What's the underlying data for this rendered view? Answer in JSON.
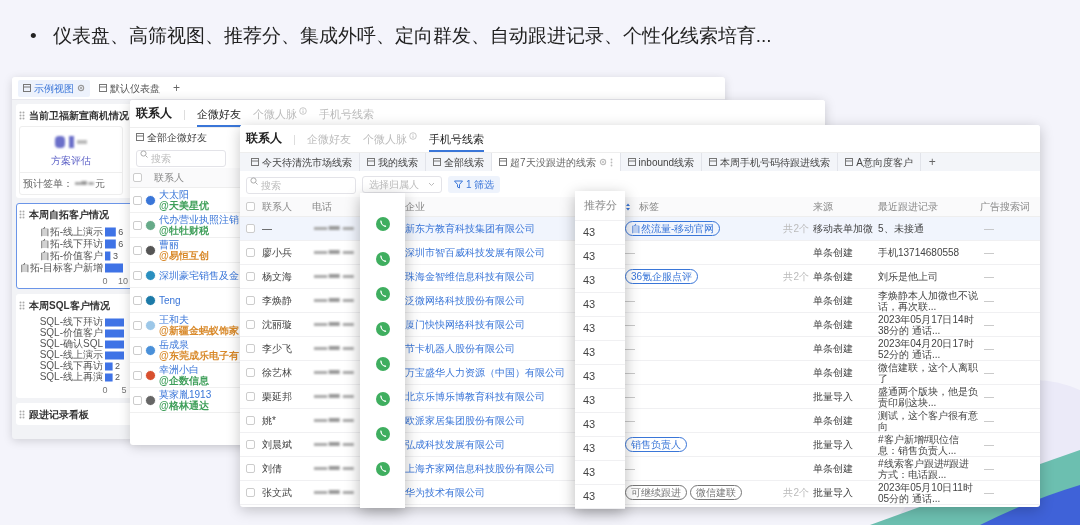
{
  "headline": {
    "bullet": "•",
    "text": "仪表盘、高筛视图、推荐分、集成外呼、定向群发、自动跟进记录、个性化线索培育..."
  },
  "dashboard_window": {
    "tabs": [
      {
        "label": "示例视图",
        "selected": true
      },
      {
        "label": "默认仪表盘",
        "selected": false
      }
    ],
    "add_tab": "+",
    "cards": [
      {
        "kind": "metric",
        "title": "当前卫福新宣商机情况",
        "selected": false,
        "metric_label": "方案评估",
        "footer_label": "预计签单：",
        "footer_unit": "元"
      },
      {
        "kind": "chart",
        "title": "本周自拓客户情况",
        "selected": true,
        "chart_data": {
          "type": "bar",
          "orientation": "horizontal",
          "categories": [
            "自拓-线上演示",
            "自拓-线下拜访",
            "自拓-价值客户",
            "自拓-目标客户新增"
          ],
          "values": [
            6,
            6,
            3,
            10
          ],
          "value_labels": [
            "6",
            "6",
            "3",
            null
          ],
          "xlim": [
            0,
            10
          ],
          "xticks": [
            0,
            10
          ]
        }
      },
      {
        "kind": "chart",
        "title": "本周SQL客户情况",
        "selected": false,
        "chart_data": {
          "type": "bar",
          "orientation": "horizontal",
          "categories": [
            "SQL-线下拜访",
            "SQL-价值客户",
            "SQL-确认SQL",
            "SQL-线上演示",
            "SQL-线下再访",
            "SQL-线上再演"
          ],
          "values": [
            5,
            5,
            5,
            5,
            2,
            2
          ],
          "value_labels": [
            null,
            null,
            null,
            null,
            "2",
            "2"
          ],
          "xlim": [
            0,
            5
          ],
          "xticks": [
            0,
            5
          ]
        }
      },
      {
        "kind": "empty",
        "title": "跟进记录看板",
        "selected": false
      }
    ]
  },
  "friends_window": {
    "title": "联系人",
    "tabs": [
      {
        "label": "企微好友",
        "selected": true,
        "info": false
      },
      {
        "label": "个微人脉",
        "selected": false,
        "info": true
      },
      {
        "label": "手机号线索",
        "selected": false,
        "info": false
      }
    ],
    "views": [
      {
        "label": "全部企微好友"
      }
    ],
    "search_placeholder": "搜索",
    "column": "联系人",
    "all_checked": false,
    "rows": [
      {
        "name": "大太阳",
        "company": "@天美星优",
        "color": "#3f9f5a",
        "checked": false
      },
      {
        "name": "代办营业执照注销",
        "company": "@牡牡财税",
        "color": "#3f9f5a",
        "checked": false
      },
      {
        "name": "曹丽",
        "company": "@易恒互创",
        "color": "#d98a2b",
        "checked": false
      },
      {
        "name": "深圳豪宅销售及金",
        "checked": false
      },
      {
        "name": "Teng",
        "checked": false
      },
      {
        "name": "王和夫",
        "company": "@新疆金蚂蚁饰家",
        "color": "#d98a2b",
        "checked": false
      },
      {
        "name": "岳成泉",
        "company": "@东莞成乐电子有",
        "color": "#d98a2b",
        "checked": false
      },
      {
        "name": "幸洲小白",
        "company": "@企数信息",
        "color": "#3f9f5a",
        "checked": false
      },
      {
        "name": "莫家胤1913",
        "company": "@格林通达",
        "color": "#3f9f5a",
        "checked": false
      }
    ]
  },
  "leads_window": {
    "title": "联系人",
    "tabs": [
      {
        "label": "企微好友",
        "selected": false,
        "info": false
      },
      {
        "label": "个微人脉",
        "selected": false,
        "info": true
      },
      {
        "label": "手机号线索",
        "selected": true,
        "info": false
      }
    ],
    "views": [
      {
        "label": "今天待清洗市场线索",
        "selected": false
      },
      {
        "label": "我的线索",
        "selected": false
      },
      {
        "label": "全部线索",
        "selected": false
      },
      {
        "label": "超7天没跟进的线索",
        "selected": true
      },
      {
        "label": "inbound线索",
        "selected": false
      },
      {
        "label": "本周手机号码待跟进线索",
        "selected": false
      },
      {
        "label": "A意向度客户",
        "selected": false
      }
    ],
    "add_view": "+",
    "search_placeholder": "搜索",
    "all_checked": false,
    "owner_select": "选择归属人",
    "filter_button": "1 筛选",
    "columns": [
      "联系人",
      "电话",
      "企业",
      "推荐分",
      "标签",
      "来源",
      "最近跟进记录",
      "广告搜索词"
    ],
    "rows": [
      {
        "name": "—",
        "company": "新东方教育科技集团有限公司",
        "score": "43",
        "tags": [
          {
            "label": "自然流量-移动官网",
            "color": "#3a76d8"
          }
        ],
        "tag_count": "共2个",
        "source": "移动表单加微",
        "followup": "5、未接通",
        "ad_keyword": "—",
        "selected": true
      },
      {
        "name": "廖小兵",
        "company": "深圳市智百威科技发展有限公司",
        "score": "43",
        "tag_text": "—",
        "source": "单条创建",
        "followup": "手机13714680558",
        "ad_keyword": "—",
        "selected": false
      },
      {
        "name": "杨文海",
        "company": "珠海金智维信息科技有限公司",
        "score": "43",
        "tags": [
          {
            "label": "36氪企服点评",
            "color": "#3a76d8"
          }
        ],
        "tag_count": "共2个",
        "source": "单条创建",
        "followup": "刘乐是他上司",
        "ad_keyword": "—",
        "selected": false
      },
      {
        "name": "李焕静",
        "company": "泛微网络科技股份有限公司",
        "score": "43",
        "tag_text": "—",
        "source": "单条创建",
        "followup": "李焕静本人加微也不说话，再次联...",
        "ad_keyword": "—",
        "selected": false
      },
      {
        "name": "沈丽璇",
        "company": "厦门快快网络科技有限公司",
        "score": "43",
        "tag_text": "—",
        "source": "单条创建",
        "followup": "2023年05月17日14时38分的 通话...",
        "ad_keyword": "—",
        "selected": false
      },
      {
        "name": "李少飞",
        "company": "节卡机器人股份有限公司",
        "score": "43",
        "tag_text": "—",
        "source": "单条创建",
        "followup": "2023年04月20日17时52分的 通话...",
        "ad_keyword": "—",
        "selected": false
      },
      {
        "name": "徐艺林",
        "company": "万宝盛华人力资源（中国）有限公司",
        "score": "43",
        "tag_text": "—",
        "source": "单条创建",
        "followup": "微信建联，这个人离职了",
        "ad_keyword": "—",
        "selected": false
      },
      {
        "name": "栗延邦",
        "company": "北京乐博乐博教育科技有限公司",
        "score": "43",
        "tag_text": "—",
        "source": "批量导入",
        "followup": "盛通两个版块，他是负责印刷这块...",
        "ad_keyword": "—",
        "selected": false
      },
      {
        "name": "姚*",
        "company": "欧派家居集团股份有限公司",
        "score": "43",
        "tag_text": "—",
        "source": "单条创建",
        "followup": "测试，这个客户很有意向",
        "ad_keyword": "—",
        "selected": false
      },
      {
        "name": "刘晨斌",
        "company": "弘成科技发展有限公司",
        "score": "43",
        "tags": [
          {
            "label": "销售负责人",
            "color": "#3a76d8"
          }
        ],
        "source": "批量导入",
        "followup": "#客户新增#职位信息：销售负责人...",
        "ad_keyword": "—",
        "selected": false
      },
      {
        "name": "刘倩",
        "company": "上海齐家网信息科技股份有限公司",
        "score": "43",
        "tag_text": "—",
        "source": "单条创建",
        "followup": "#线索客户跟进#跟进方式：电话跟...",
        "ad_keyword": "—",
        "selected": false
      },
      {
        "name": "张文武",
        "company": "华为技术有限公司",
        "score": "43",
        "tags": [
          {
            "label": "可继续跟进",
            "color": "#777777"
          },
          {
            "label": "微信建联",
            "color": "#777777"
          }
        ],
        "tag_count": "共2个",
        "source": "批量导入",
        "followup": "2023年05月10日11时05分的 通话...",
        "ad_keyword": "—",
        "selected": false
      }
    ]
  }
}
